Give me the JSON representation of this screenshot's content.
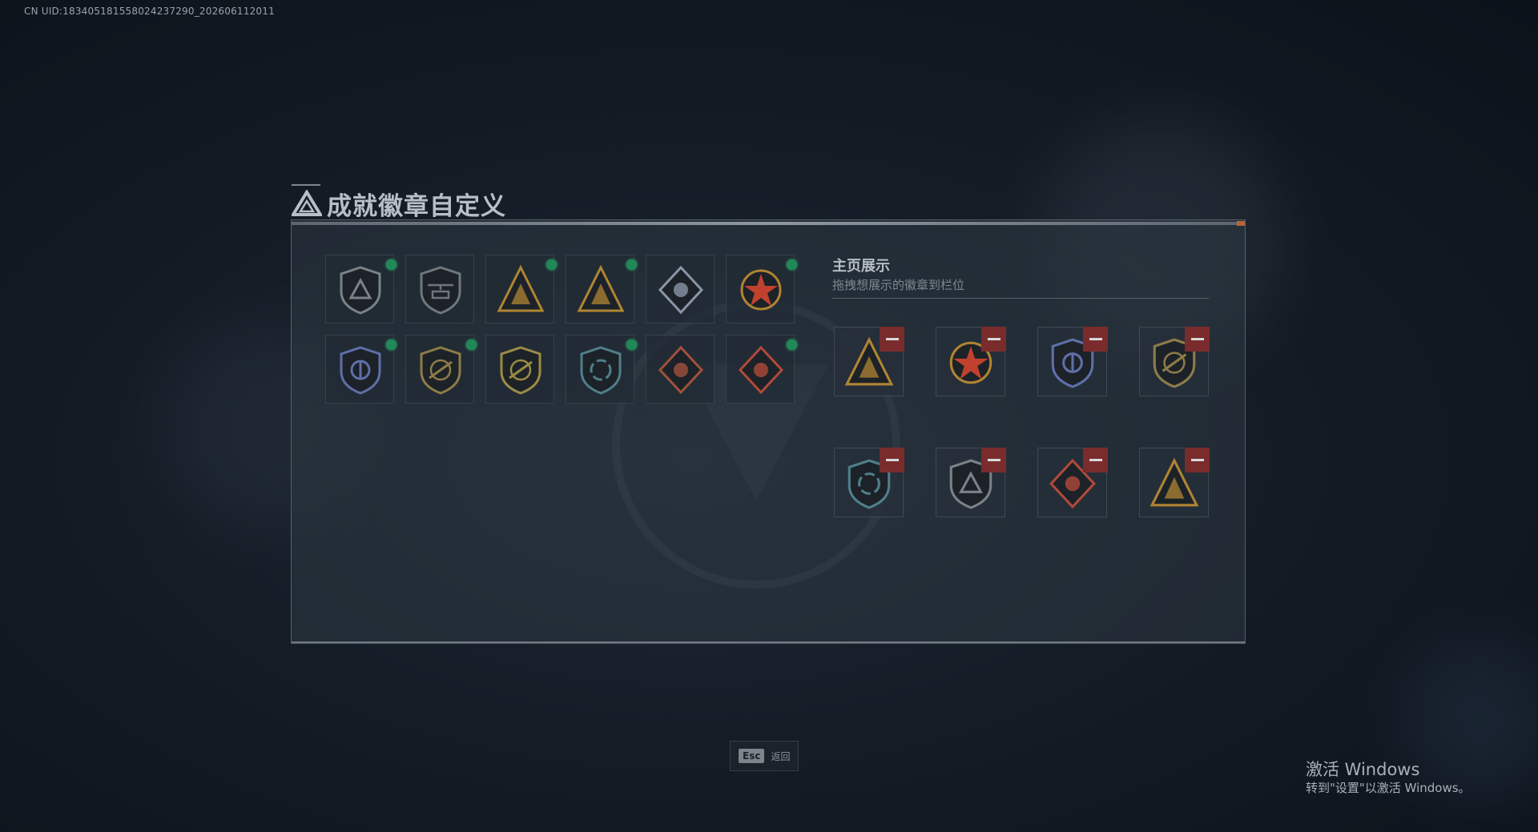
{
  "uid_text": "CN UID:1834051815580242372​90_202606112011",
  "page": {
    "title": "成就徽章自定义",
    "icon": "triangle-logo-icon"
  },
  "inventory": {
    "items": [
      {
        "icon": "shield-triangle-badge-icon",
        "color": "#7a8288",
        "equipped": true
      },
      {
        "icon": "helicopter-badge-icon",
        "color": "#6f777d",
        "equipped": false
      },
      {
        "icon": "claw-triangle-badge-icon",
        "color": "#b08432",
        "equipped": true
      },
      {
        "icon": "soldiers-triangle-badge-icon",
        "color": "#b08432",
        "equipped": true
      },
      {
        "icon": "rose-diamond-badge-icon",
        "color": "#8a95a6",
        "equipped": false
      },
      {
        "icon": "star-wreath-badge-icon",
        "color": "#c0422e",
        "equipped": true
      },
      {
        "icon": "police-shield-badge-icon",
        "color": "#5f6fa8",
        "equipped": true
      },
      {
        "icon": "shield-rifle-badge-icon",
        "color": "#8d7c48",
        "equipped": true
      },
      {
        "icon": "shield-rifle-gold-badge-icon",
        "color": "#9b8c45",
        "equipped": false
      },
      {
        "icon": "shield-arrows-badge-icon",
        "color": "#4f7f8a",
        "equipped": true
      },
      {
        "icon": "wolf-diamond-badge-icon",
        "color": "#a0513c",
        "equipped": false
      },
      {
        "icon": "dagger-diamond-badge-icon",
        "color": "#b04a3a",
        "equipped": true
      }
    ]
  },
  "showcase": {
    "title": "主页展示",
    "subtitle": "拖拽想展示的徽章到栏位",
    "slots": [
      {
        "icon": "soldiers-triangle-badge-icon",
        "color": "#b08432"
      },
      {
        "icon": "star-wreath-badge-icon",
        "color": "#c0422e"
      },
      {
        "icon": "police-shield-badge-icon",
        "color": "#5f6fa8"
      },
      {
        "icon": "shield-rifle-badge-icon",
        "color": "#8d7c48"
      },
      {
        "icon": "shield-arrows-badge-icon",
        "color": "#4f7f8a"
      },
      {
        "icon": "shield-triangle-badge-icon",
        "color": "#7a8288"
      },
      {
        "icon": "dagger-diamond-badge-icon",
        "color": "#b04a3a"
      },
      {
        "icon": "claw-triangle-badge-icon",
        "color": "#b08432"
      }
    ]
  },
  "footer": {
    "esc_key": "Esc",
    "esc_label": "返回"
  },
  "windows_watermark": {
    "title": "激活 Windows",
    "subtitle": "转到\"设置\"以激活 Windows。"
  }
}
